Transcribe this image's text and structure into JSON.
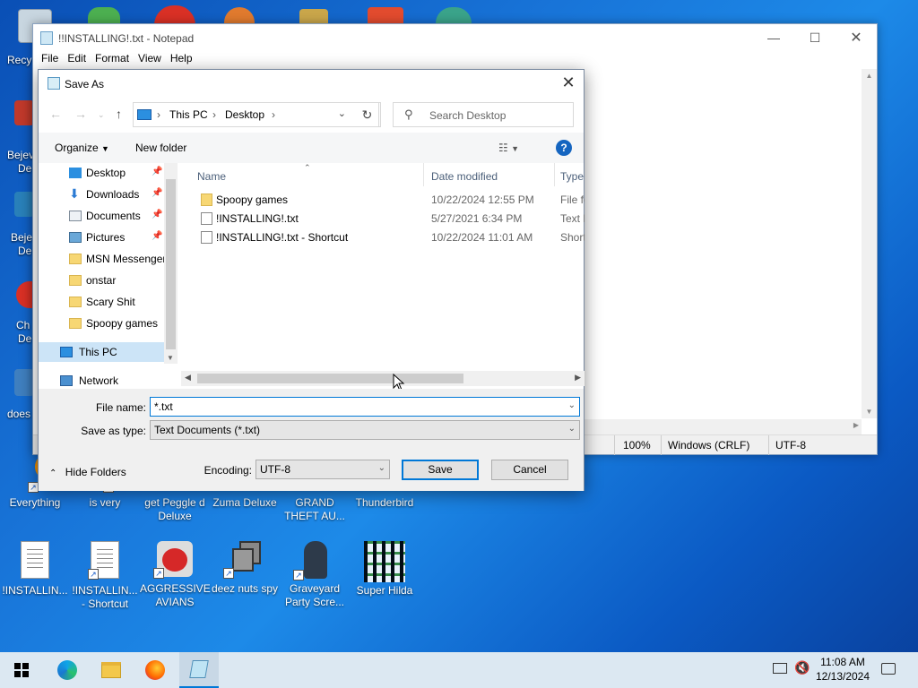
{
  "desktop": {
    "partial_labels": [
      "Recy",
      "Bejev",
      "De",
      "Beje",
      "De",
      "Ch",
      "De",
      "does"
    ],
    "row1": [
      {
        "label": "Everything",
        "shortcut": true
      },
      {
        "label": "is very",
        "shortcut": true
      },
      {
        "label": "get Peggle d Deluxe",
        "shortcut": true
      },
      {
        "label": "Zuma Deluxe",
        "shortcut": true
      },
      {
        "label": "GRAND THEFT AU...",
        "shortcut": true
      },
      {
        "label": "Thunderbird",
        "shortcut": true
      }
    ],
    "row2": [
      {
        "label": "!INSTALLIN...",
        "shortcut": false
      },
      {
        "label": "!INSTALLIN... - Shortcut",
        "shortcut": true
      },
      {
        "label": "AGGRESSIVE AVIANS",
        "shortcut": true
      },
      {
        "label": "deez nuts spy",
        "shortcut": true
      },
      {
        "label": "Graveyard Party Scre...",
        "shortcut": true
      },
      {
        "label": "Super Hilda",
        "shortcut": false
      }
    ]
  },
  "notepad": {
    "title": "!!INSTALLING!.txt - Notepad",
    "menu": [
      "File",
      "Edit",
      "Format",
      "View",
      "Help"
    ],
    "status": {
      "zoom": "100%",
      "line_ending": "Windows (CRLF)",
      "encoding": "UTF-8"
    }
  },
  "dialog": {
    "title": "Save As",
    "breadcrumb": [
      "This PC",
      "Desktop"
    ],
    "search_placeholder": "Search Desktop",
    "toolbar": {
      "organize": "Organize",
      "new_folder": "New folder"
    },
    "nav_items": [
      {
        "label": "Desktop",
        "pinned": true,
        "icon": "desktop-icon"
      },
      {
        "label": "Downloads",
        "pinned": true,
        "icon": "download-icon"
      },
      {
        "label": "Documents",
        "pinned": true,
        "icon": "documents-icon"
      },
      {
        "label": "Pictures",
        "pinned": true,
        "icon": "pictures-icon"
      },
      {
        "label": "MSN Messenger",
        "pinned": false,
        "icon": "folder-icon"
      },
      {
        "label": "onstar",
        "pinned": false,
        "icon": "folder-icon"
      },
      {
        "label": "Scary Shit",
        "pinned": false,
        "icon": "folder-icon"
      },
      {
        "label": "Spoopy games",
        "pinned": false,
        "icon": "folder-icon"
      },
      {
        "label": "This PC",
        "pinned": false,
        "icon": "computer-icon"
      },
      {
        "label": "Network",
        "pinned": false,
        "icon": "network-icon"
      }
    ],
    "columns": [
      "Name",
      "Date modified",
      "Type"
    ],
    "files": [
      {
        "name": "Spoopy games",
        "date": "10/22/2024 12:55 PM",
        "type": "File fo",
        "kind": "folder"
      },
      {
        "name": "!INSTALLING!.txt",
        "date": "5/27/2021 6:34 PM",
        "type": "Text D",
        "kind": "txt"
      },
      {
        "name": "!INSTALLING!.txt - Shortcut",
        "date": "10/22/2024 11:01 AM",
        "type": "Shortc",
        "kind": "shortcut"
      }
    ],
    "file_name_label": "File name:",
    "file_name_value": "*.txt",
    "save_type_label": "Save as type:",
    "save_type_value": "Text Documents (*.txt)",
    "hide_folders": "Hide Folders",
    "encoding_label": "Encoding:",
    "encoding_value": "UTF-8",
    "save": "Save",
    "cancel": "Cancel"
  },
  "taskbar": {
    "time": "11:08 AM",
    "date": "12/13/2024"
  },
  "colors": {
    "accent": "#0078d7",
    "selection": "#cce4f7",
    "desktop": "#1874d8"
  }
}
